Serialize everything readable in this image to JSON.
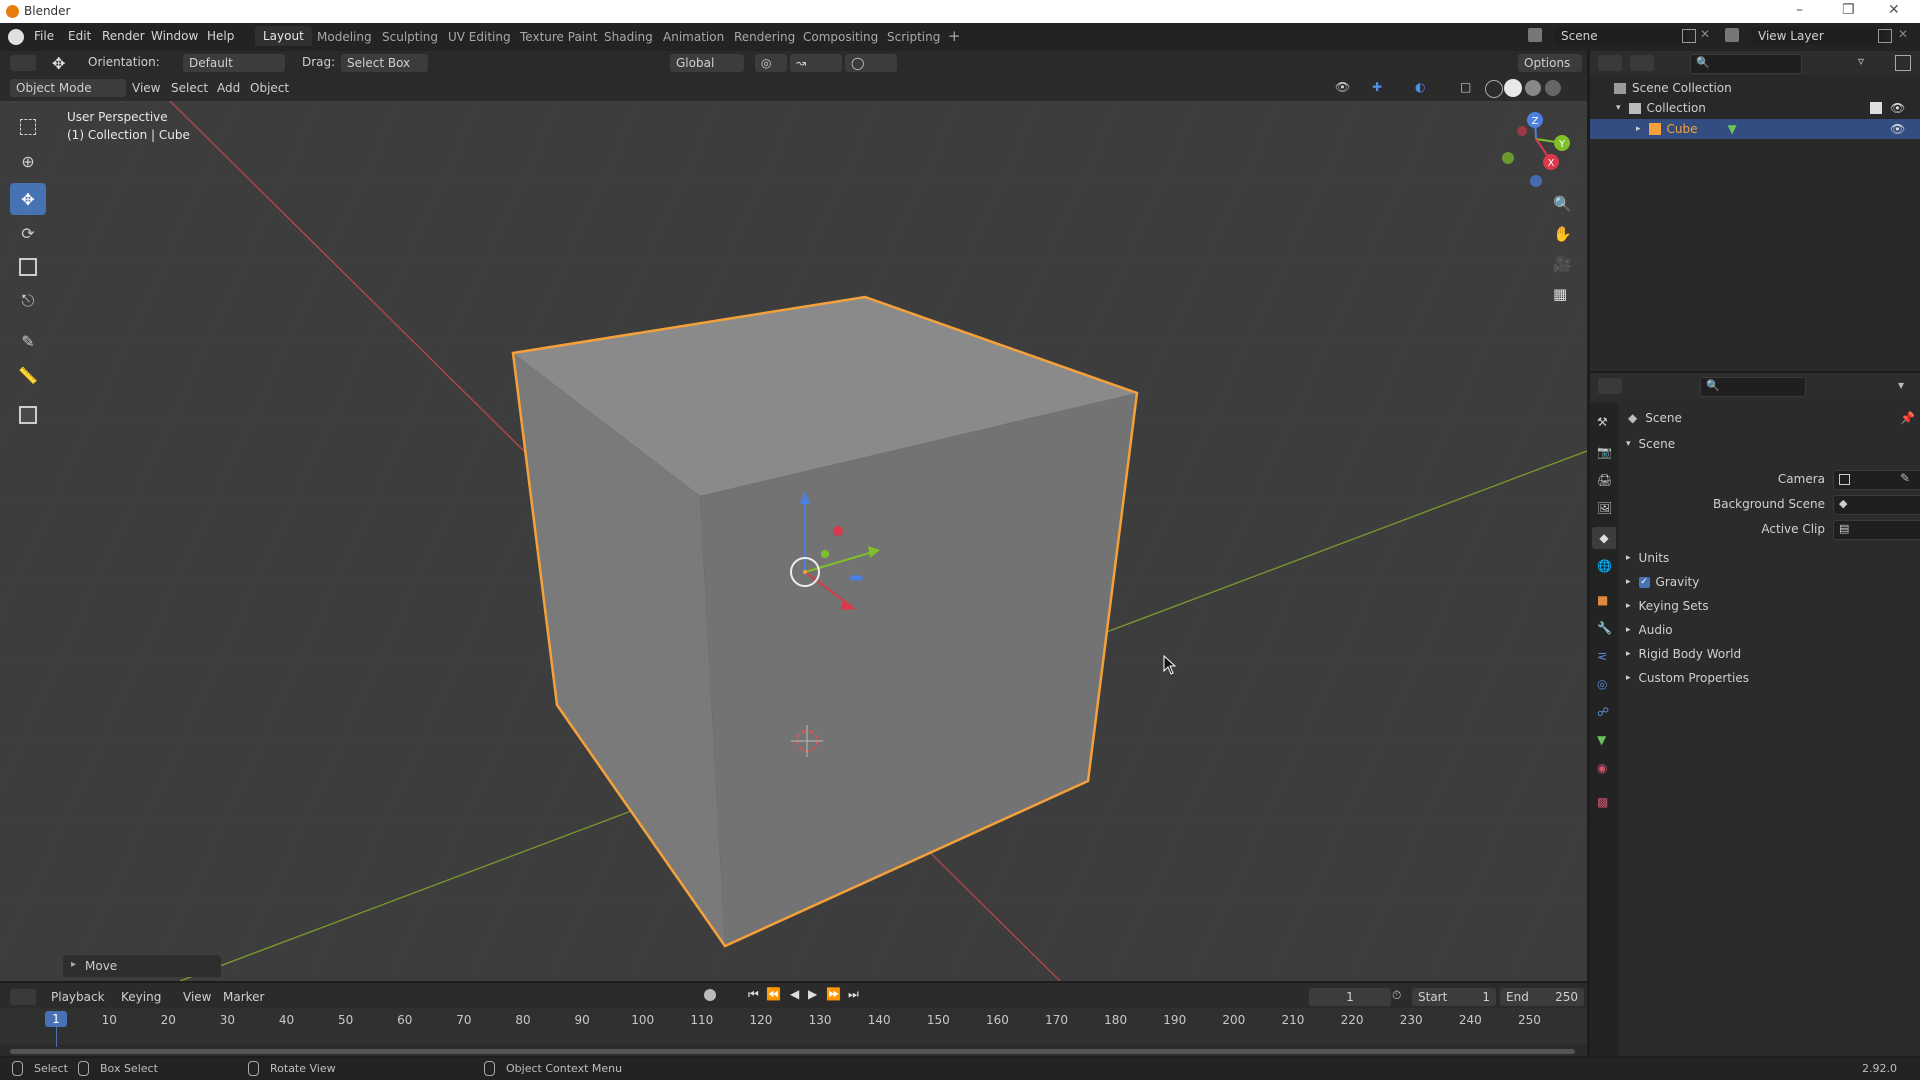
{
  "window": {
    "title": "Blender",
    "version": "2.92.0"
  },
  "menu": {
    "file": "File",
    "edit": "Edit",
    "render": "Render",
    "window": "Window",
    "help": "Help",
    "workspaces": [
      "Layout",
      "Modeling",
      "Sculpting",
      "UV Editing",
      "Texture Paint",
      "Shading",
      "Animation",
      "Rendering",
      "Compositing",
      "Scripting"
    ],
    "add_workspace": "+",
    "scene_name": "Scene",
    "view_layer": "View Layer"
  },
  "toolheader": {
    "orientation_label": "Orientation:",
    "orientation_value": "Default",
    "drag_label": "Drag:",
    "drag_value": "Select Box",
    "transform_orientation": "Global",
    "options": "Options"
  },
  "viewport_header": {
    "mode": "Object Mode",
    "view": "View",
    "select": "Select",
    "add": "Add",
    "object": "Object"
  },
  "viewport": {
    "perspective": "User Perspective",
    "collection_info": "(1) Collection | Cube",
    "operator_panel": "Move",
    "gizmo_axes": {
      "x": "X",
      "y": "Y",
      "z": "Z"
    }
  },
  "outliner": {
    "scene_collection": "Scene Collection",
    "collection": "Collection",
    "cube": "Cube"
  },
  "properties": {
    "header": "Scene",
    "section": "Scene",
    "camera_label": "Camera",
    "background_scene_label": "Background Scene",
    "active_clip_label": "Active Clip",
    "panels": [
      "Units",
      "Gravity",
      "Keying Sets",
      "Audio",
      "Rigid Body World",
      "Custom Properties"
    ],
    "gravity_checked": true
  },
  "timeline": {
    "playback": "Playback",
    "keying": "Keying",
    "view": "View",
    "marker": "Marker",
    "current_frame": "1",
    "start_label": "Start",
    "start_value": "1",
    "end_label": "End",
    "end_value": "250",
    "playhead": "1",
    "ticks": [
      "10",
      "20",
      "30",
      "40",
      "50",
      "60",
      "70",
      "80",
      "90",
      "100",
      "110",
      "120",
      "130",
      "140",
      "150",
      "160",
      "170",
      "180",
      "190",
      "200",
      "210",
      "220",
      "230",
      "240",
      "250"
    ]
  },
  "statusbar": {
    "select": "Select",
    "box_select": "Box Select",
    "rotate_view": "Rotate View",
    "context_menu": "Object Context Menu"
  },
  "colors": {
    "accent": "#4772b3",
    "selection_outline": "#f5a13b",
    "brand": "#e87d0d"
  }
}
